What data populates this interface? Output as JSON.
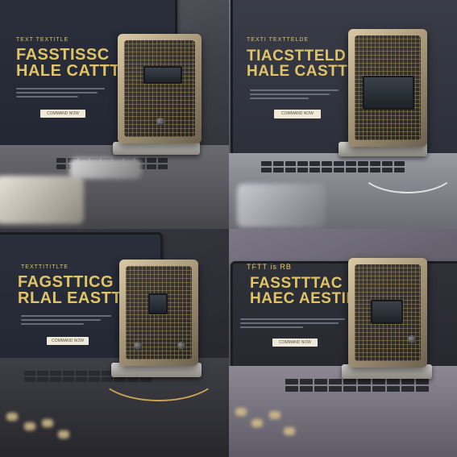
{
  "panels": [
    {
      "kicker": "TEXT TEXTITLE",
      "headline_line1": "FASSTISSC",
      "headline_line2": "HALE CATTTNG",
      "cta": "COMMAND NOW"
    },
    {
      "kicker": "TEXTI TEXTTELDE",
      "headline_line1": "TIACSTTELD",
      "headline_line2": "HALE CASTTNG",
      "cta": "COMMAND NOW"
    },
    {
      "kicker": "TEXTTITITLTE",
      "headline_line1": "FAGSTTICG",
      "headline_line2": "RLAL EASTTNG",
      "cta": "COMMAND NOW"
    },
    {
      "kicker": "TFTT is RB",
      "headline_line1": "FASSTTTAC",
      "headline_line2": "HAEC AESTING",
      "cta": "COMMAND NOW"
    }
  ]
}
